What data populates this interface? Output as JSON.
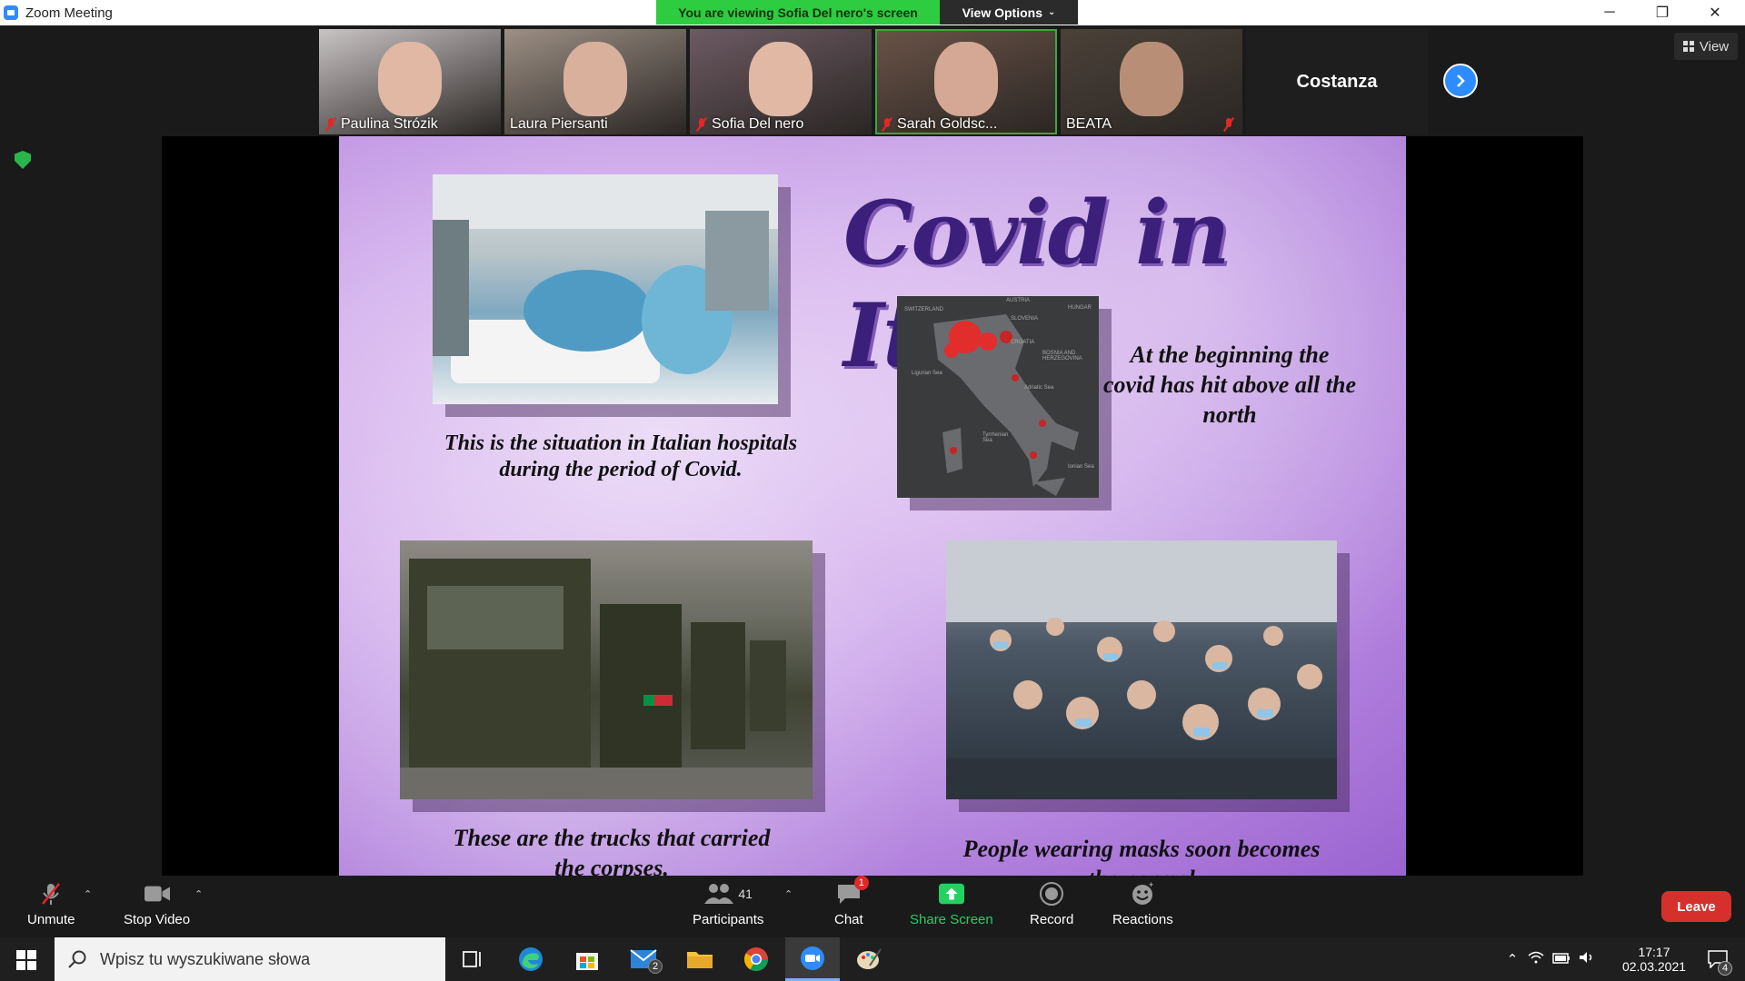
{
  "window": {
    "title": "Zoom Meeting",
    "viewing_banner": "You are viewing Sofia Del nero's screen",
    "view_options": "View Options",
    "minimize": "─",
    "restore": "❐",
    "close": "✕"
  },
  "participants_strip": [
    {
      "name": "Paulina Strózik",
      "muted": true,
      "bg": "#c9c4c4",
      "face": "#e1b8a3"
    },
    {
      "name": "Laura Piersanti",
      "muted": false,
      "bg": "#9c8f84",
      "face": "#d8b09c"
    },
    {
      "name": "Sofia Del nero",
      "muted": true,
      "bg": "#6d5a63",
      "face": "#e0b8a4"
    },
    {
      "name": "Sarah Goldsc...",
      "muted": true,
      "bg": "#6a5347",
      "face": "#d4a894"
    },
    {
      "name": "BEATA",
      "muted": false,
      "bg": "#4b4138",
      "face": "#b88f76"
    }
  ],
  "extra_tile": {
    "name": "Costanza"
  },
  "view_button": "View",
  "slide": {
    "title": "Covid in Italy",
    "caption_hospitals": "This is the situation in Italian hospitals during the period of Covid.",
    "caption_north": "At the beginning the covid has hit above all the north",
    "caption_trucks": "These are the trucks that carried the corpses.",
    "caption_masks": "People wearing masks soon becomes the normal",
    "map_labels": [
      "SWITZERLAND",
      "AUSTRIA",
      "HUNGAR",
      "SLOVENIA",
      "CROATIA",
      "BOSNIA AND HERZEGOVINA",
      "Tyrrhenian Sea",
      "Ionian Sea",
      "Adriatic Sea",
      "Ligurian Sea"
    ]
  },
  "toolbar": {
    "unmute": "Unmute",
    "stop_video": "Stop Video",
    "participants": "Participants",
    "participants_count": "41",
    "chat": "Chat",
    "chat_badge": "1",
    "share_screen": "Share Screen",
    "record": "Record",
    "reactions": "Reactions",
    "leave": "Leave"
  },
  "taskbar": {
    "search_placeholder": "Wpisz tu wyszukiwane słowa",
    "mail_badge": "2",
    "time": "17:17",
    "date": "02.03.2021",
    "notifications_badge": "4"
  }
}
